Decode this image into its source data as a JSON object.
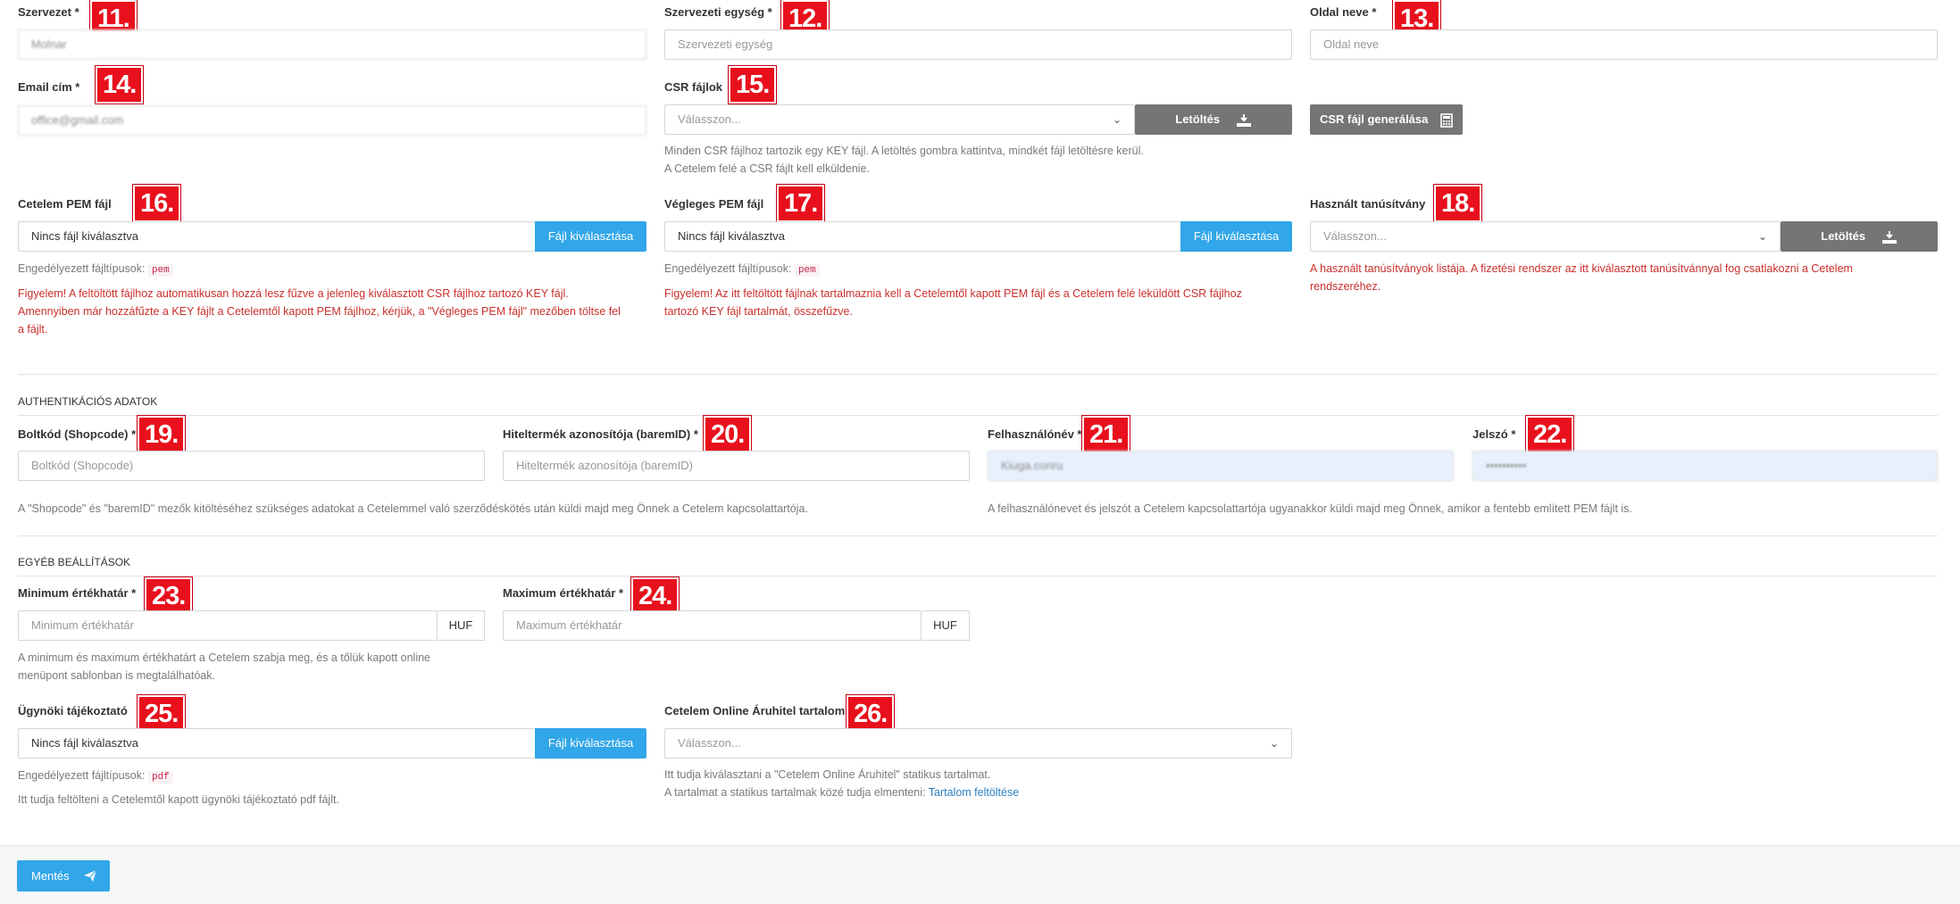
{
  "fields": {
    "org": {
      "label": "Szervezet *",
      "badge": "11.",
      "value": "Molnar"
    },
    "org_unit": {
      "label": "Szervezeti egység *",
      "badge": "12.",
      "placeholder": "Szervezeti egység"
    },
    "page_name": {
      "label": "Oldal neve *",
      "badge": "13.",
      "placeholder": "Oldal neve"
    },
    "email": {
      "label": "Email cím *",
      "badge": "14.",
      "value": "office@gmail.com"
    },
    "csr_files": {
      "label": "CSR fájlok",
      "badge": "15.",
      "placeholder": "Válasszon...",
      "download": "Letöltés",
      "generate": "CSR fájl generálása",
      "help1": "Minden CSR fájlhoz tartozik egy KEY fájl. A letöltés gombra kattintva, mindkét fájl letöltésre kerül.",
      "help2": "A Cetelem felé a CSR fájlt kell elküldenie."
    },
    "cetelem_pem": {
      "label": "Cetelem PEM fájl",
      "badge": "16.",
      "value": "Nincs fájl kiválasztva",
      "button": "Fájl kiválasztása",
      "allowed": "Engedélyezett fájltípusok:",
      "ext": "pem",
      "warn1": "Figyelem! A feltöltött fájlhoz automatikusan hozzá lesz fűzve a jelenleg kiválasztott CSR fájlhoz tartozó KEY fájl.",
      "warn2": "Amennyiben már hozzáfűzte a KEY fájlt a Cetelemtől kapott PEM fájlhoz, kérjük, a \"Végleges PEM fájl\" mezőben töltse fel",
      "warn3": "a fájlt."
    },
    "final_pem": {
      "label": "Végleges PEM fájl",
      "badge": "17.",
      "value": "Nincs fájl kiválasztva",
      "button": "Fájl kiválasztása",
      "allowed": "Engedélyezett fájltípusok:",
      "ext": "pem",
      "warn1": "Figyelem! Az itt feltöltött fájlnak tartalmaznia kell a Cetelemtől kapott PEM fájl és a Cetelem felé leküldött CSR fájlhoz",
      "warn2": "tartozó KEY fájl tartalmát, összefűzve."
    },
    "used_cert": {
      "label": "Használt tanúsítvány",
      "badge": "18.",
      "placeholder": "Válasszon...",
      "download": "Letöltés",
      "warn1": "A használt tanúsítványok listája. A fizetési rendszer az itt kiválasztott tanúsítvánnyal fog csatlakozni a Cetelem",
      "warn2": "rendszeréhez."
    }
  },
  "auth": {
    "title": "AUTHENTIKÁCIÓS ADATOK",
    "shopcode": {
      "label": "Boltkód (Shopcode) *",
      "badge": "19.",
      "placeholder": "Boltkód (Shopcode)"
    },
    "baremid": {
      "label": "Hiteltermék azonosítója (baremID) *",
      "badge": "20.",
      "placeholder": "Hiteltermék azonosítója (baremID)"
    },
    "username": {
      "label": "Felhasználónév *",
      "badge": "21.",
      "value": "Kiuga.conru"
    },
    "password": {
      "label": "Jelszó *",
      "badge": "22.",
      "value": "••••••••••"
    },
    "help_left": "A \"Shopcode\" és \"baremID\" mezők kitöltéséhez szükséges adatokat a Cetelemmel való szerződéskötés után küldi majd meg Önnek a Cetelem kapcsolattartója.",
    "help_right": "A felhasználónevet és jelszót a Cetelem kapcsolattartója ugyanakkor küldi majd meg Önnek, amikor a fentebb említett PEM fájlt is."
  },
  "other": {
    "title": "EGYÉB BEÁLLÍTÁSOK",
    "min": {
      "label": "Minimum értékhatár *",
      "badge": "23.",
      "placeholder": "Minimum értékhatár",
      "unit": "HUF"
    },
    "max": {
      "label": "Maximum értékhatár *",
      "badge": "24.",
      "placeholder": "Maximum értékhatár",
      "unit": "HUF"
    },
    "minmax_help1": "A minimum és maximum értékhatárt a Cetelem szabja meg, és a tőlük kapott online",
    "minmax_help2": "menüpont sablonban is megtalálhatóak.",
    "agent": {
      "label": "Ügynöki tájékoztató",
      "badge": "25.",
      "value": "Nincs fájl kiválasztva",
      "button": "Fájl kiválasztása",
      "allowed": "Engedélyezett fájltípusok:",
      "ext": "pdf",
      "help": "Itt tudja feltölteni a Cetelemtől kapott ügynöki tájékoztató pdf fájlt."
    },
    "content": {
      "label": "Cetelem Online Áruhitel tartalom",
      "badge": "26.",
      "placeholder": "Válasszon...",
      "help1": "Itt tudja kiválasztani a \"Cetelem Online Áruhitel\" statikus tartalmat.",
      "help2": "A tartalmat a statikus tartalmak közé tudja elmenteni:",
      "link": "Tartalom feltöltése"
    }
  },
  "footer": {
    "save": "Mentés"
  }
}
